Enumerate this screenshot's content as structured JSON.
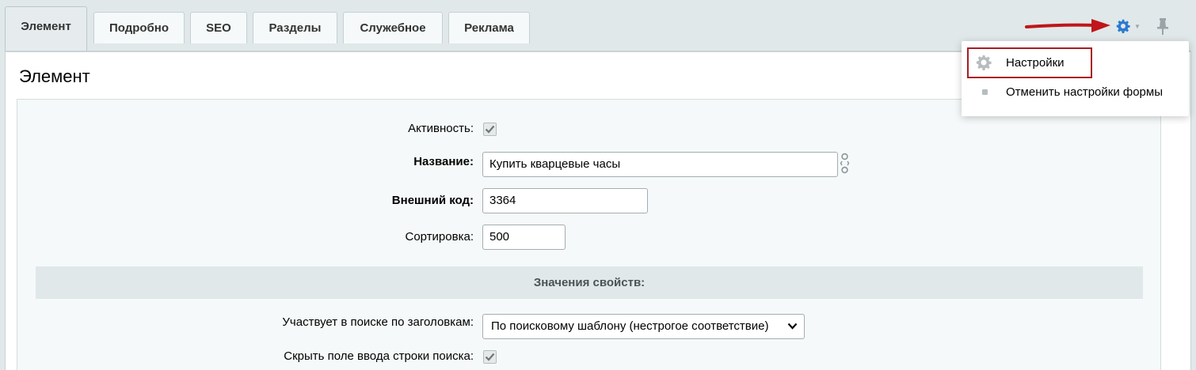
{
  "tabs": [
    {
      "label": "Элемент",
      "active": true
    },
    {
      "label": "Подробно",
      "active": false
    },
    {
      "label": "SEO",
      "active": false
    },
    {
      "label": "Разделы",
      "active": false
    },
    {
      "label": "Служебное",
      "active": false
    },
    {
      "label": "Реклама",
      "active": false
    }
  ],
  "toolbar": {
    "settings_icon": "gear-icon",
    "pin_icon": "pin-icon",
    "accent_color": "#2a7ad1",
    "arrow_color": "#c0151a"
  },
  "settings_menu": {
    "items": [
      {
        "label": "Настройки",
        "icon": "gear-icon",
        "highlighted": true
      },
      {
        "label": "Отменить настройки формы",
        "icon": "bullet-icon",
        "highlighted": false
      }
    ],
    "highlight_color": "#a81c23"
  },
  "section": {
    "title": "Элемент"
  },
  "form": {
    "active": {
      "label": "Активность:",
      "checked": true
    },
    "name": {
      "label": "Название:",
      "value": "Купить кварцевые часы",
      "icon": "link-icon"
    },
    "external_code": {
      "label": "Внешний код:",
      "value": "3364"
    },
    "sort": {
      "label": "Сортировка:",
      "value": "500"
    },
    "properties_header": "Значения свойств:",
    "search_by_titles": {
      "label": "Участвует в поиске по заголовкам:",
      "value": "По поисковому шаблону (нестрогое соответствие)"
    },
    "hide_search_field": {
      "label": "Скрыть поле ввода строки поиска:",
      "checked": true
    }
  }
}
